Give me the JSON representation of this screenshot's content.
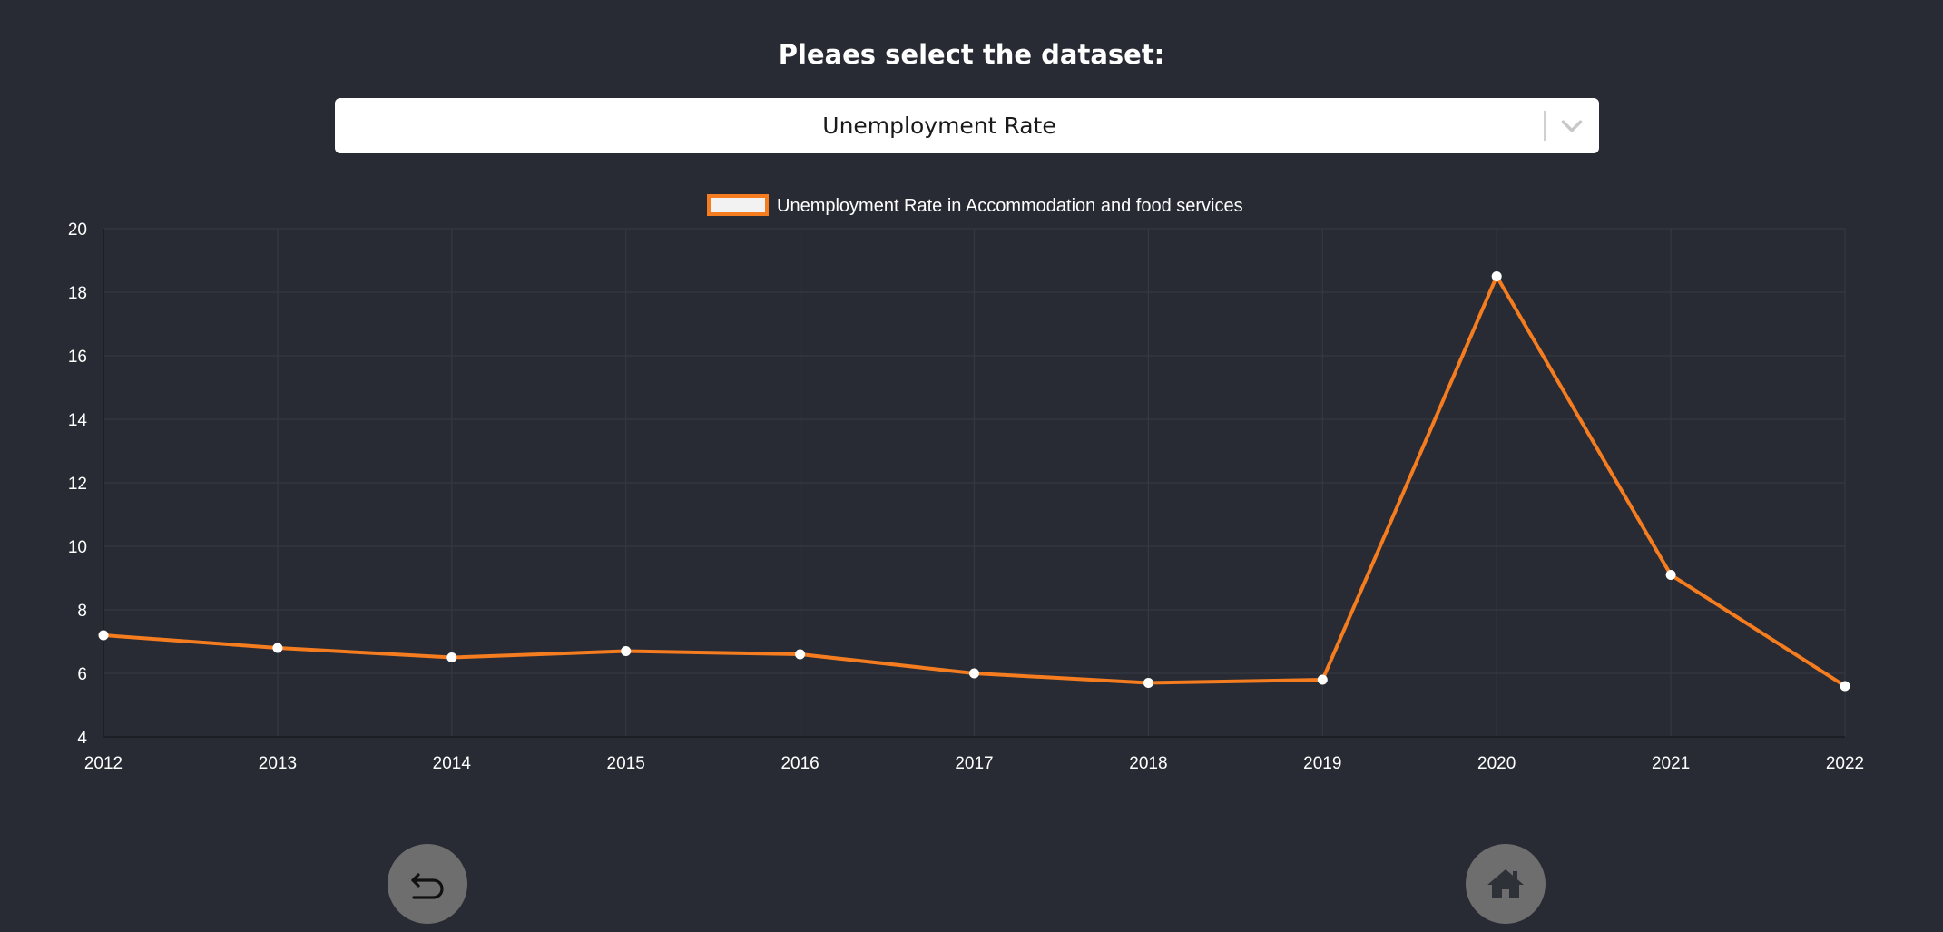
{
  "header": {
    "prompt": "Pleaes select the dataset:"
  },
  "dataset_select": {
    "selected": "Unemployment Rate"
  },
  "nav": {
    "back_icon": "back-arrow-icon",
    "home_icon": "home-icon"
  },
  "colors": {
    "background": "#282b33",
    "series_line": "#f57c1f",
    "point_fill": "#ffffff",
    "grid": "#343842"
  },
  "chart_data": {
    "type": "line",
    "title": "",
    "xlabel": "",
    "ylabel": "",
    "x": [
      "2012",
      "2013",
      "2014",
      "2015",
      "2016",
      "2017",
      "2018",
      "2019",
      "2020",
      "2021",
      "2022"
    ],
    "series": [
      {
        "name": "Unemployment Rate in Accommodation and food services",
        "values": [
          7.2,
          6.8,
          6.5,
          6.7,
          6.6,
          6.0,
          5.7,
          5.8,
          18.5,
          9.1,
          5.6
        ]
      }
    ],
    "ylim": [
      4,
      20
    ],
    "yticks": [
      "4",
      "6",
      "8",
      "10",
      "12",
      "14",
      "16",
      "18",
      "20"
    ],
    "grid": true,
    "legend": "top-center"
  }
}
